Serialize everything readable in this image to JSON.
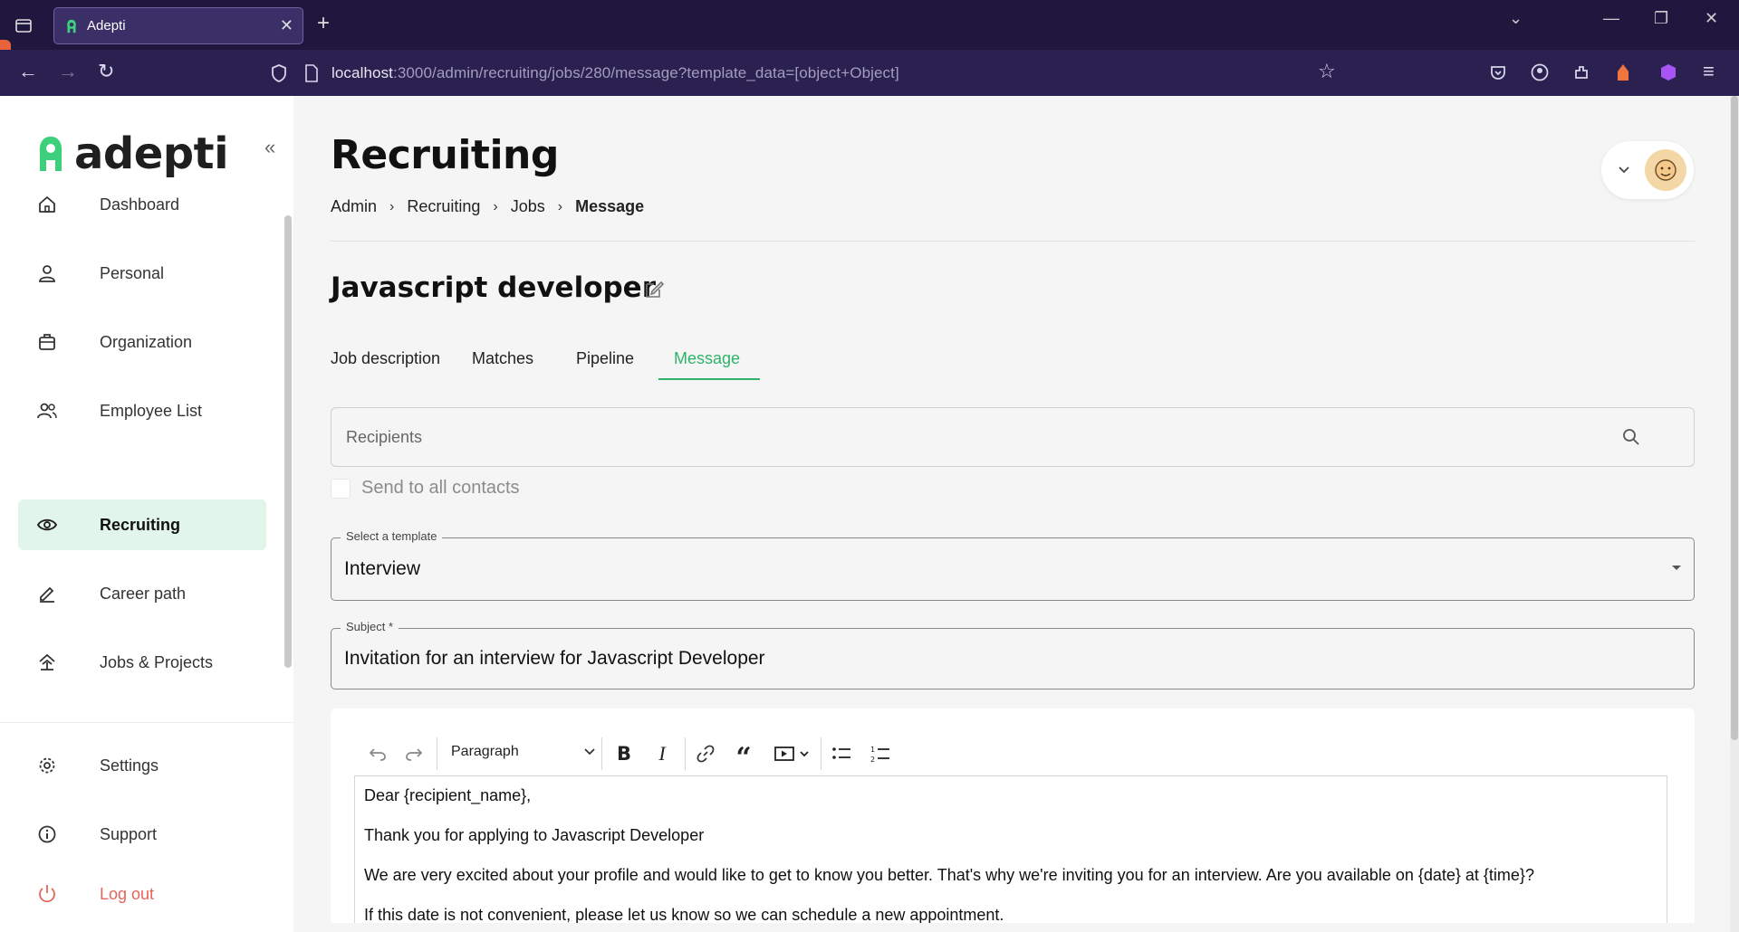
{
  "browser": {
    "tab_title": "Adepti",
    "url_host": "localhost",
    "url_rest": ":3000/admin/recruiting/jobs/280/message?template_data=[object+Object]"
  },
  "sidebar": {
    "logo_text": "adepti",
    "items": [
      {
        "label": "Dashboard",
        "icon": "home-icon"
      },
      {
        "label": "Personal",
        "icon": "person-icon"
      },
      {
        "label": "Organization",
        "icon": "briefcase-icon"
      },
      {
        "label": "Employee List",
        "icon": "people-icon"
      },
      {
        "label": "Recruiting",
        "icon": "eye-icon",
        "active": true
      },
      {
        "label": "Career path",
        "icon": "pencil-icon"
      },
      {
        "label": "Jobs & Projects",
        "icon": "jobs-icon"
      }
    ],
    "bottom_items": [
      {
        "label": "Settings",
        "icon": "gear-icon"
      },
      {
        "label": "Support",
        "icon": "info-icon"
      },
      {
        "label": "Log out",
        "icon": "power-icon"
      }
    ]
  },
  "header": {
    "title": "Recruiting",
    "breadcrumb": [
      "Admin",
      "Recruiting",
      "Jobs",
      "Message"
    ]
  },
  "job": {
    "title": "Javascript developer",
    "tabs": [
      "Job description",
      "Matches",
      "Pipeline",
      "Message"
    ],
    "active_tab": "Message"
  },
  "form": {
    "recipients_placeholder": "Recipients",
    "send_all_label": "Send to all contacts",
    "template_label": "Select a template",
    "template_value": "Interview",
    "subject_label": "Subject *",
    "subject_value": "Invitation for an interview for Javascript Developer"
  },
  "editor": {
    "paragraph_style": "Paragraph",
    "body": [
      "Dear {recipient_name},",
      "Thank you for applying to Javascript Developer",
      "We are very excited about your profile and would like to get to know you better. That's why we're inviting you for an interview. Are you available on {date} at {time}?",
      "If this date is not convenient, please let us know so we can schedule a new appointment."
    ]
  },
  "colors": {
    "accent": "#2fb36b",
    "active_bg": "#e2f5ea",
    "logout": "#e6645a",
    "browser_bg": "#2b2150"
  }
}
